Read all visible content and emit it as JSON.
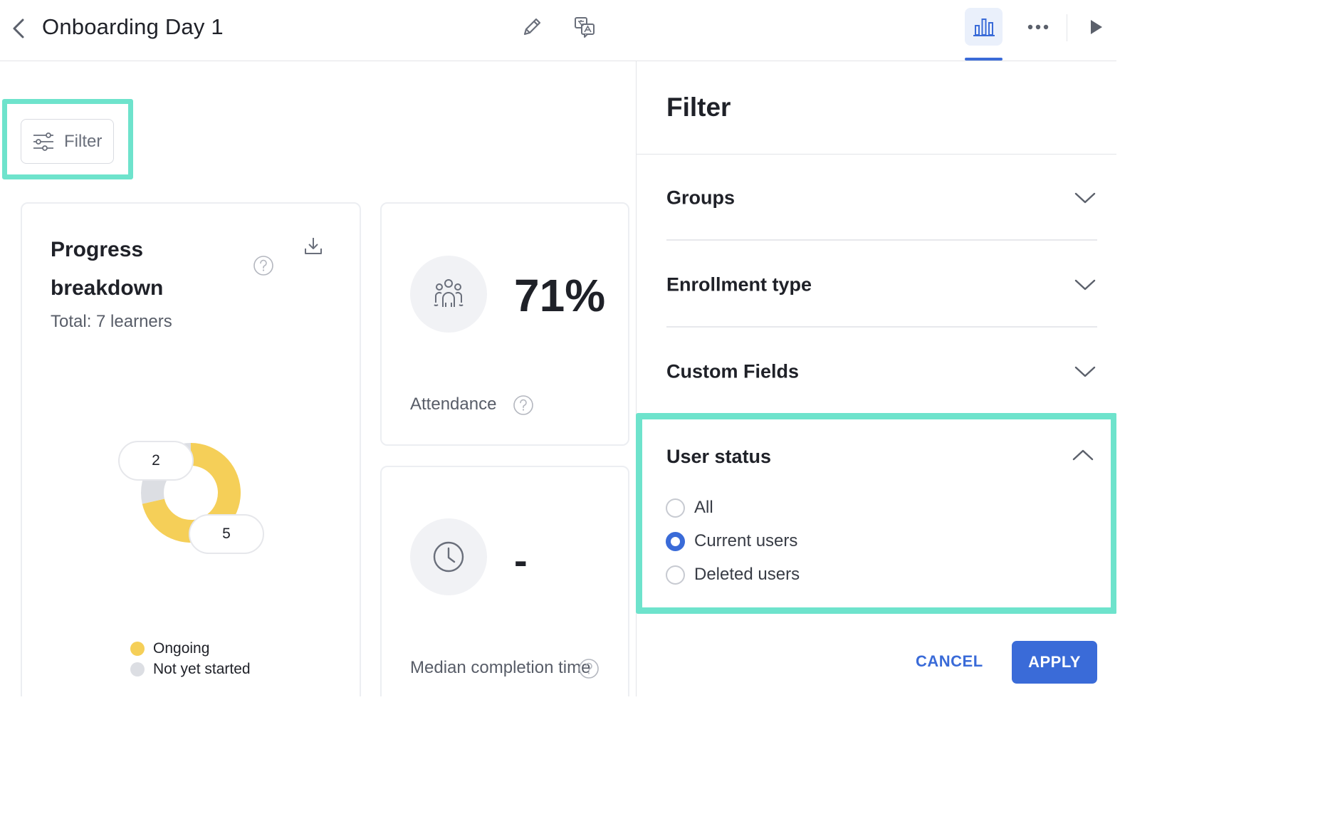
{
  "header": {
    "title": "Onboarding Day 1"
  },
  "toolbar": {
    "filter_label": "Filter"
  },
  "progress_card": {
    "title": "Progress breakdown",
    "total": "Total: 7 learners",
    "legend": [
      {
        "label": "Ongoing",
        "color": "#f5cf58"
      },
      {
        "label": "Not yet started",
        "color": "#dcdee3"
      }
    ]
  },
  "chart_data": {
    "type": "pie",
    "categories": [
      "Ongoing",
      "Not yet started"
    ],
    "values": [
      5,
      2
    ],
    "data_labels": [
      "5",
      "2"
    ],
    "colors": [
      "#f5cf58",
      "#dcdee3"
    ]
  },
  "attendance_card": {
    "value": "71%",
    "label": "Attendance"
  },
  "median_card": {
    "value": "-",
    "label": "Median completion time"
  },
  "filter_panel": {
    "title": "Filter",
    "sections": [
      {
        "label": "Groups"
      },
      {
        "label": "Enrollment type"
      },
      {
        "label": "Custom Fields"
      }
    ],
    "user_status": {
      "title": "User status",
      "options": [
        "All",
        "Current users",
        "Deleted users"
      ],
      "selected": "Current users"
    },
    "cancel_label": "CANCEL",
    "apply_label": "APPLY"
  },
  "colors": {
    "accent": "#3a6bd8",
    "highlight": "#6ee3cc",
    "donut_ongoing": "#f5cf58",
    "donut_not_started": "#dcdee3"
  },
  "icons": {
    "back": "chevron-left-icon",
    "edit": "pencil-icon",
    "translate": "translate-icon",
    "stats": "bar-chart-icon",
    "more": "more-horizontal-icon",
    "play": "play-icon",
    "filter": "sliders-icon",
    "download": "download-icon",
    "help": "help-circle-icon",
    "learners": "group-icon",
    "clock": "clock-icon",
    "expand": "chevron-down-icon",
    "collapse": "chevron-up-icon"
  }
}
